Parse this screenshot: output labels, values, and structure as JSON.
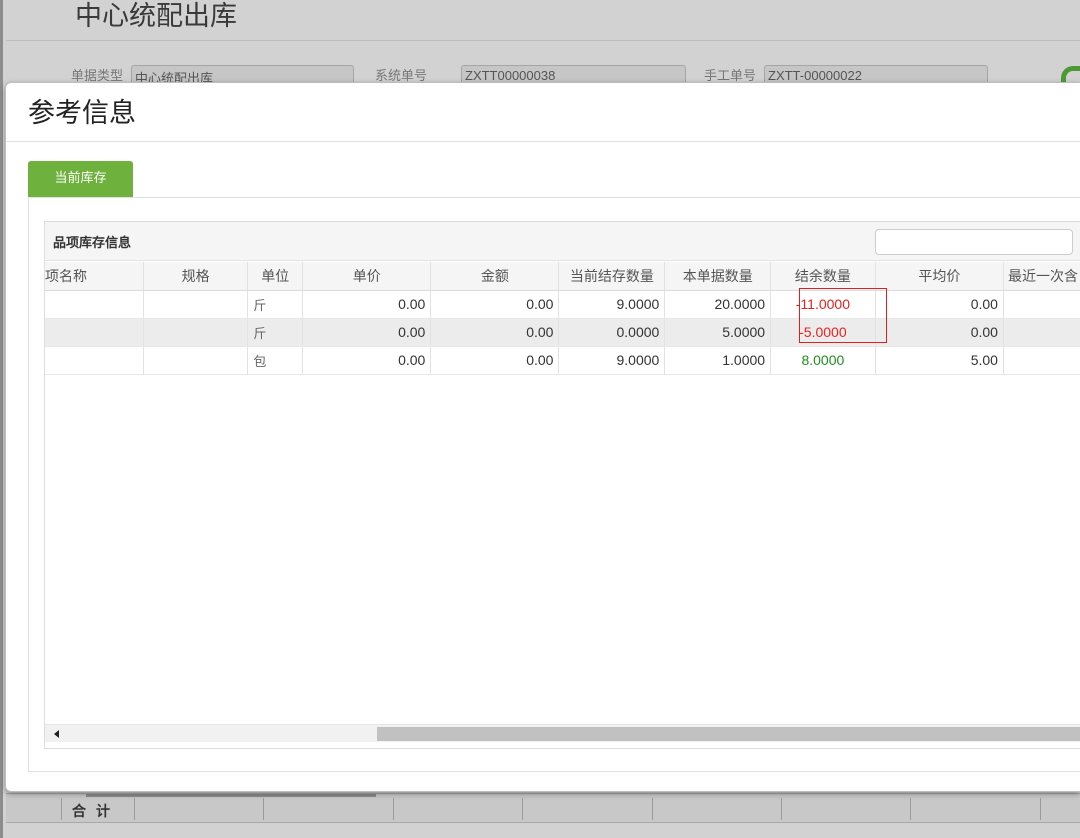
{
  "background": {
    "title": "中心统配出库",
    "fields": [
      {
        "label": "单据类型",
        "value": "中心统配出库"
      },
      {
        "label": "系统单号",
        "value": "ZXTT00000038"
      },
      {
        "label": "手工单号",
        "value": "ZXTT-00000022"
      }
    ],
    "footer_sum_label": "合计"
  },
  "modal": {
    "title": "参考信息",
    "tab_label": "当前库存",
    "grid": {
      "caption": "品项库存信息",
      "search_value": "",
      "columns": [
        "项名称",
        "规格",
        "单位",
        "单价",
        "金额",
        "当前结存数量",
        "本单据数量",
        "结余数量",
        "平均价",
        "最近一次含"
      ],
      "rows": [
        {
          "name": "",
          "spec": "",
          "unit": "斤",
          "price": "0.00",
          "amount": "0.00",
          "current_qty": "9.0000",
          "doc_qty": "20.0000",
          "balance": "-11.0000",
          "avg_price": "0.00",
          "last": ""
        },
        {
          "name": "",
          "spec": "",
          "unit": "斤",
          "price": "0.00",
          "amount": "0.00",
          "current_qty": "0.0000",
          "doc_qty": "5.0000",
          "balance": "-5.0000",
          "avg_price": "0.00",
          "last": ""
        },
        {
          "name": "",
          "spec": "",
          "unit": "包",
          "price": "0.00",
          "amount": "0.00",
          "current_qty": "9.0000",
          "doc_qty": "1.0000",
          "balance": "8.0000",
          "avg_price": "5.00",
          "last": ""
        }
      ]
    }
  },
  "colors": {
    "tab_green": "#6fb13d",
    "negative_red": "#e52222",
    "positive_green": "#1f8f1f",
    "highlight_box": "#e02020"
  }
}
